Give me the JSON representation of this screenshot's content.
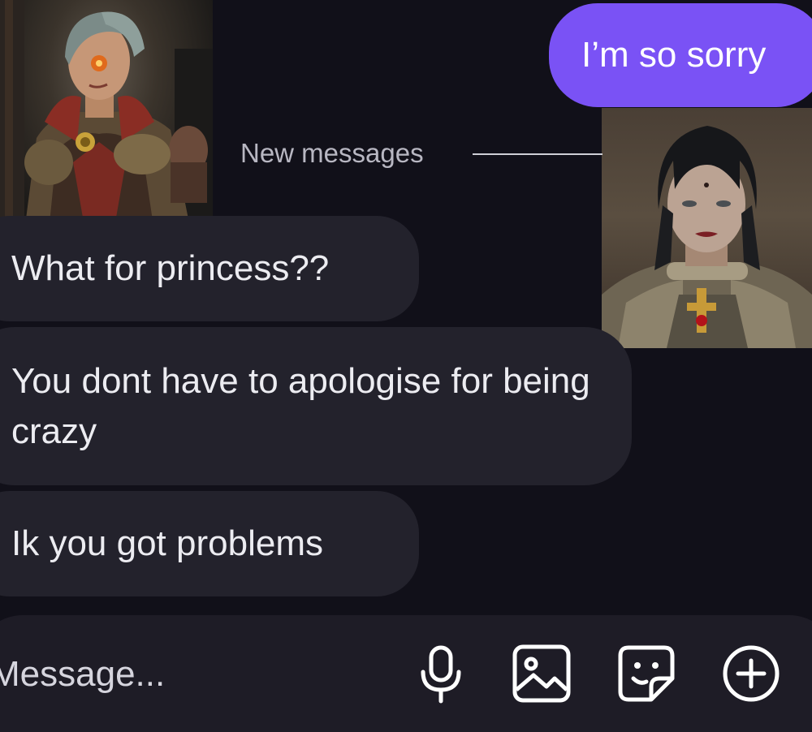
{
  "messages": {
    "outgoing": [
      {
        "text": "I’m so sorry"
      }
    ],
    "divider": "New messages",
    "incoming": [
      {
        "text": "What for princess??"
      },
      {
        "text": "You dont have to apologise for being crazy"
      },
      {
        "text": "Ik you got problems"
      }
    ]
  },
  "composer": {
    "placeholder": "Message...",
    "visible_text": "Message...",
    "icons": [
      "microphone-icon",
      "image-icon",
      "sticker-icon",
      "plus-circle-icon"
    ]
  },
  "colors": {
    "background": "#111019",
    "outgoing_bubble": "#7a52f5",
    "incoming_bubble": "#23222c",
    "composer": "#1e1c26"
  }
}
